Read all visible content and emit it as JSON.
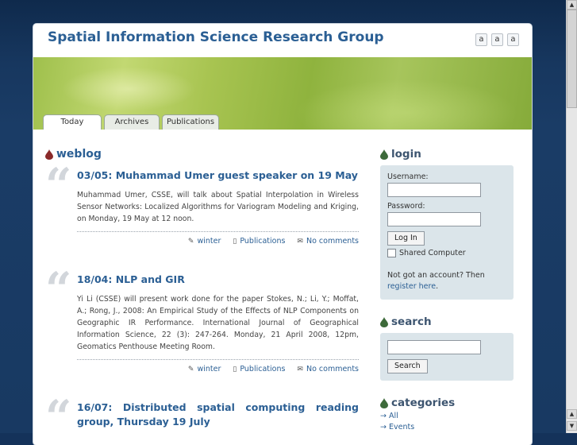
{
  "header": {
    "title": "Spatial Information Science Research Group",
    "font_sizes": [
      "a",
      "a",
      "a"
    ]
  },
  "tabs": [
    {
      "label": "Today",
      "active": true
    },
    {
      "label": "Archives",
      "active": false
    },
    {
      "label": "Publications",
      "active": false
    }
  ],
  "weblog": {
    "title": "weblog",
    "posts": [
      {
        "title": "03/05: Muhammad Umer guest speaker on 19 May",
        "body": "Muhammad Umer, CSSE, will talk about Spatial Interpolation in Wireless Sensor Networks: Localized Algorithms for Variogram Modeling and Kriging, on Monday, 19 May at 12 noon.",
        "author": "winter",
        "category": "Publications",
        "comments": "No comments"
      },
      {
        "title": "18/04: NLP and GIR",
        "body": "Yi Li (CSSE) will present work done for the paper Stokes, N.; Li, Y.; Moffat, A.; Rong, J., 2008: An Empirical Study of the Effects of NLP Components on Geographic IR Performance. International Journal of Geographical Information Science, 22 (3): 247-264. Monday, 21 April 2008, 12pm, Geomatics Penthouse Meeting Room.",
        "author": "winter",
        "category": "Publications",
        "comments": "No comments"
      },
      {
        "title": "16/07: Distributed spatial computing reading group, Thursday 19 July"
      }
    ]
  },
  "login": {
    "title": "login",
    "username_label": "Username:",
    "password_label": "Password:",
    "button": "Log In",
    "shared_label": "Shared Computer",
    "no_account": "Not got an account? Then",
    "register": "register here",
    "register_suffix": "."
  },
  "search": {
    "title": "search",
    "button": "Search"
  },
  "categories": {
    "title": "categories",
    "items": [
      "All",
      "Events"
    ]
  },
  "colors": {
    "background": "#14325a",
    "link": "#2b5f94",
    "sidebar_box": "#dbe5ea",
    "section_icon_main": "#8a2a2a",
    "section_icon_side": "#3d6a3a"
  }
}
